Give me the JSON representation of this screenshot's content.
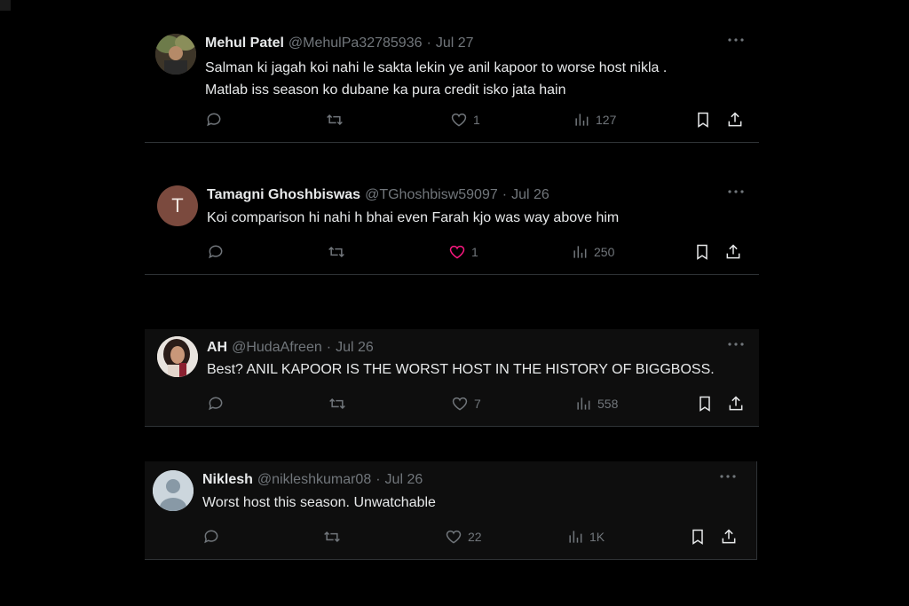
{
  "colors": {
    "background": "#000000",
    "text": "#e7e9ea",
    "muted": "#71767b",
    "like": "#f91880",
    "divider": "#2f3336"
  },
  "tweets": [
    {
      "name": "Mehul Patel",
      "handle": "@MehulPa32785936",
      "date": "Jul 27",
      "text": "Salman ki jagah koi nahi le sakta lekin ye anil kapoor to worse host nikla .\nMatlab iss season ko dubane ka pura credit isko jata hain",
      "avatar": "photo",
      "reply_label": "",
      "retweet_label": "",
      "like_count": "1",
      "views": "127",
      "liked": false
    },
    {
      "name": "Tamagni Ghoshbiswas",
      "handle": "@TGhoshbisw59097",
      "date": "Jul 26",
      "text": "Koi comparison hi nahi h bhai even Farah kjo was way above him",
      "avatar": "T",
      "reply_label": "",
      "retweet_label": "",
      "like_count": "1",
      "views": "250",
      "liked": true
    },
    {
      "name": "AH",
      "handle": "@HudaAfreen",
      "date": "Jul 26",
      "text": "Best? ANIL KAPOOR IS THE WORST HOST IN THE HISTORY OF BIGGBOSS.",
      "avatar": "photo",
      "reply_label": "",
      "retweet_label": "",
      "like_count": "7",
      "views": "558",
      "liked": false
    },
    {
      "name": "Niklesh",
      "handle": "@nikleshkumar08",
      "date": "Jul 26",
      "text": "Worst host this season. Unwatchable",
      "avatar": "default",
      "reply_label": "",
      "retweet_label": "",
      "like_count": "22",
      "views": "1K",
      "liked": false
    }
  ]
}
